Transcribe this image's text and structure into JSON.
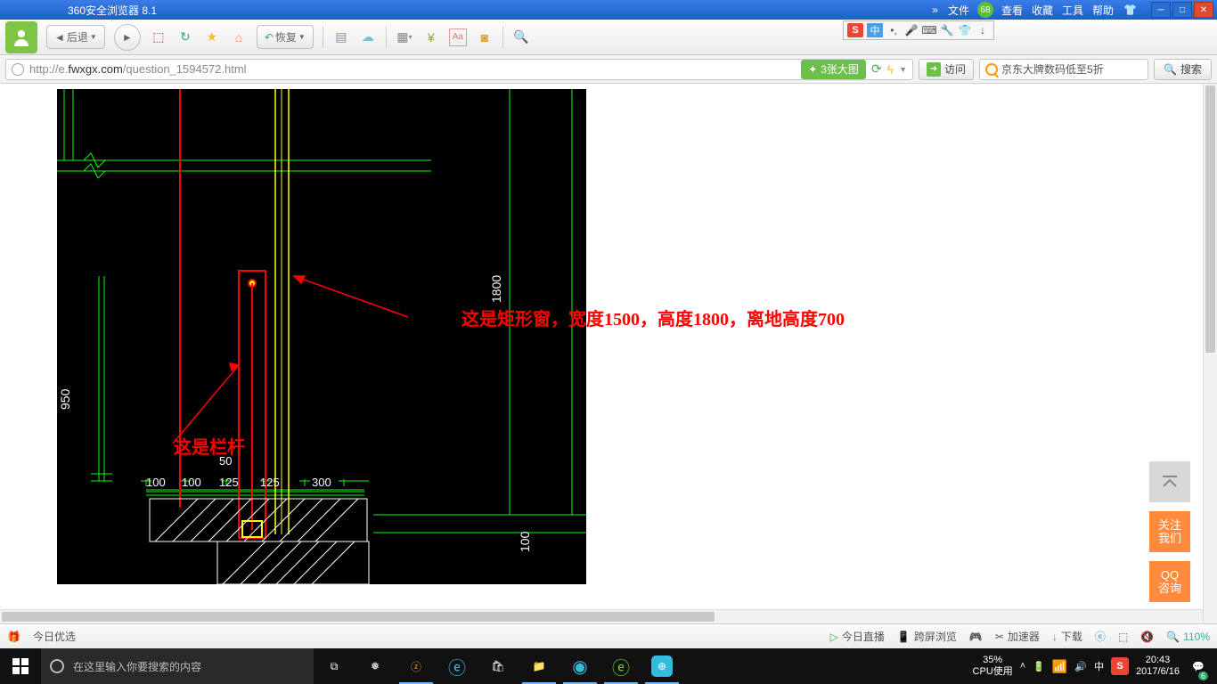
{
  "titlebar": {
    "app_name": "360安全浏览器 8.1",
    "menu": {
      "file": "文件",
      "view": "查看",
      "fav": "收藏",
      "tools": "工具",
      "help": "帮助"
    },
    "badge": "68"
  },
  "toolbar": {
    "back_label": "后退",
    "restore_label": "恢复"
  },
  "addressbar": {
    "url_prefix": "http://e.",
    "url_host": "fwxgx.com",
    "url_path": "/question_1594572.html",
    "pill_label": "3张大图",
    "visit_label": "访问",
    "search_placeholder": "京东大牌数码低至5折",
    "search_btn": "搜索"
  },
  "cad": {
    "annotation_window": "这是矩形窗，宽度1500，高度1800，离地高度700",
    "annotation_rail": "这是栏杆",
    "dims": {
      "d950": "950",
      "d1800": "1800",
      "d100": "100",
      "d100b": "100",
      "d125a": "125",
      "d125b": "125",
      "d50": "50",
      "d300": "300",
      "d100r": "100"
    }
  },
  "side": {
    "follow_l1": "关注",
    "follow_l2": "我们",
    "qq_l1": "QQ",
    "qq_l2": "咨询"
  },
  "statusbar": {
    "today": "今日优选",
    "live": "今日直播",
    "cross": "跨屏浏览",
    "accel": "加速器",
    "download": "下载",
    "zoom": "110%"
  },
  "taskbar": {
    "cortana_placeholder": "在这里输入你要搜索的内容",
    "cpu_pct": "35%",
    "cpu_label": "CPU使用",
    "time": "20:43",
    "date": "2017/6/16",
    "ime": "中",
    "notif_count": "6"
  }
}
